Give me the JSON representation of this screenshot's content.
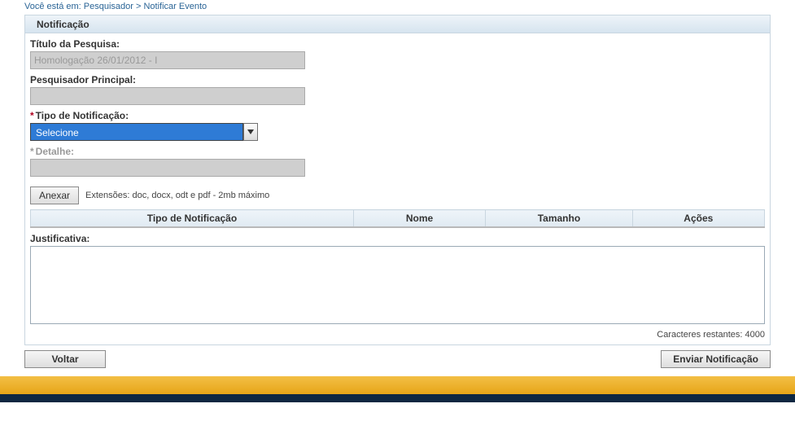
{
  "breadcrumb": {
    "prefix": "Você está em: ",
    "part1": "Pesquisador",
    "sep": " > ",
    "part2": "Notificar Evento"
  },
  "panel": {
    "title": "Notificação"
  },
  "form": {
    "titulo_label": "Título da Pesquisa:",
    "titulo_value": "Homologação 26/01/2012 - I",
    "pesq_label": "Pesquisador Principal:",
    "pesq_value": "",
    "tipo_label": "Tipo de Notificação:",
    "tipo_selected": "Selecione",
    "detalhe_label": "Detalhe:",
    "detalhe_value": ""
  },
  "attach": {
    "button": "Anexar",
    "hint": "Extensões: doc, docx, odt e pdf - 2mb máximo"
  },
  "table": {
    "col_tipo": "Tipo de Notificação",
    "col_nome": "Nome",
    "col_tam": "Tamanho",
    "col_acoes": "Ações"
  },
  "just": {
    "label": "Justificativa:",
    "value": "",
    "remaining_prefix": "Caracteres restantes: ",
    "remaining_value": "4000"
  },
  "actions": {
    "voltar": "Voltar",
    "enviar": "Enviar Notificação"
  }
}
